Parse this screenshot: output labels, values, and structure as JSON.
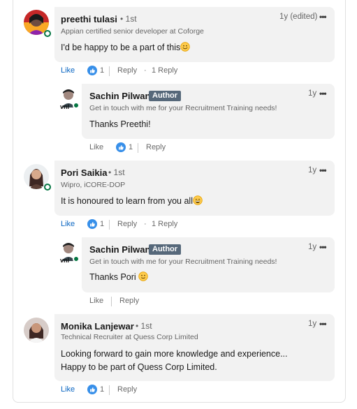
{
  "comments": [
    {
      "name": "preethi tulasi",
      "degree": "• 1st",
      "headline": "Appian certified senior developer at Coforge",
      "time": "1y (edited)",
      "more": "•••",
      "text": "I'd be happy to be a part of this",
      "emoji": "smile",
      "like": "Like",
      "reactions": "1",
      "reply": "Reply",
      "replies": "1 Reply",
      "reply_item": {
        "name": "Sachin Pilwan",
        "badge": "Author",
        "headline": "Get in touch with me for your Recruitment Training needs!",
        "time": "1y",
        "more": "•••",
        "text": "Thanks Preethi!",
        "like": "Like",
        "reactions": "1",
        "reply": "Reply"
      }
    },
    {
      "name": "Pori Saikia",
      "degree": "• 1st",
      "headline": "Wipro, iCORE-DOP",
      "time": "1y",
      "more": "•••",
      "text": "It is honoured to learn from you all",
      "emoji": "grin",
      "like": "Like",
      "reactions": "1",
      "reply": "Reply",
      "replies": "1 Reply",
      "reply_item": {
        "name": "Sachin Pilwan",
        "badge": "Author",
        "headline": "Get in touch with me for your Recruitment Training needs!",
        "time": "1y",
        "more": "•••",
        "text": "Thanks Pori",
        "like": "Like",
        "reply": "Reply"
      }
    },
    {
      "name": "Monika Lanjewar",
      "degree": "• 1st",
      "headline": "Technical Recruiter at Quess Corp Limited",
      "time": "1y",
      "more": "•••",
      "text_line1": "Looking forward to gain more knowledge and experience...",
      "text_line2": "Happy to be part of Quess Corp Limited.",
      "like": "Like",
      "reactions": "1",
      "reply": "Reply"
    }
  ],
  "icons": {
    "like_reaction": "thumbs-up-icon",
    "more": "more-options-icon"
  },
  "colors": {
    "like_blue": "#0a66c2",
    "reaction_blue": "#378fe9",
    "author_badge": "#56687a",
    "presence_green": "#057642",
    "bubble_bg": "#f2f2f2"
  }
}
